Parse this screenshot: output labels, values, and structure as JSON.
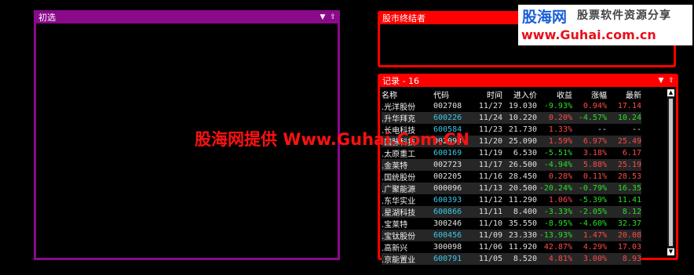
{
  "panels": {
    "initial": {
      "title": "初选"
    },
    "terminator": {
      "title": "股市终结者"
    },
    "record": {
      "title": "记录 - 16"
    }
  },
  "table": {
    "headers": [
      "名称",
      "代码",
      "时间",
      "进入价",
      "收益",
      "涨幅",
      "最新"
    ],
    "rows": [
      {
        "name": ".光洋股份",
        "code": "002708",
        "time": "11/27",
        "price": "19.030",
        "gain": "-9.93%",
        "chg": "0.94%",
        "last": "17.14"
      },
      {
        "name": ".升华拜克",
        "code": "600226",
        "time": "11/24",
        "price": "10.220",
        "gain": "0.20%",
        "chg": "-4.57%",
        "last": "10.24"
      },
      {
        "name": ".长电科技",
        "code": "600584",
        "time": "11/23",
        "price": "21.730",
        "gain": "1.33%",
        "chg": "--",
        "last": "--"
      },
      {
        "name": ".国脉科技",
        "code": "002093",
        "time": "11/20",
        "price": "25.090",
        "gain": "1.59%",
        "chg": "6.97%",
        "last": "25.49"
      },
      {
        "name": ".太原重工",
        "code": "600169",
        "time": "11/19",
        "price": "6.530",
        "gain": "-5.51%",
        "chg": "3.18%",
        "last": "6.17"
      },
      {
        "name": ".金莱特",
        "code": "002723",
        "time": "11/17",
        "price": "26.500",
        "gain": "-4.94%",
        "chg": "5.88%",
        "last": "25.19"
      },
      {
        "name": ".国统股份",
        "code": "002205",
        "time": "11/16",
        "price": "28.450",
        "gain": "0.28%",
        "chg": "0.11%",
        "last": "28.53"
      },
      {
        "name": ".广聚能源",
        "code": "000096",
        "time": "11/13",
        "price": "20.500",
        "gain": "-20.24%",
        "chg": "-0.79%",
        "last": "16.35"
      },
      {
        "name": ".东华实业",
        "code": "600393",
        "time": "11/12",
        "price": "11.290",
        "gain": "1.06%",
        "chg": "-5.39%",
        "last": "11.41"
      },
      {
        "name": ".星湖科技",
        "code": "600866",
        "time": "11/11",
        "price": "8.400",
        "gain": "-3.33%",
        "chg": "-2.05%",
        "last": "8.12"
      },
      {
        "name": ".宝莱特",
        "code": "300246",
        "time": "11/10",
        "price": "35.550",
        "gain": "-8.95%",
        "chg": "-4.60%",
        "last": "32.37"
      },
      {
        "name": ".宝钛股份",
        "code": "600456",
        "time": "11/09",
        "price": "23.330",
        "gain": "-13.93%",
        "chg": "1.47%",
        "last": "20.08"
      },
      {
        "name": ".高新兴",
        "code": "300098",
        "time": "11/06",
        "price": "11.920",
        "gain": "42.87%",
        "chg": "4.29%",
        "last": "17.03"
      },
      {
        "name": ".京能置业",
        "code": "600791",
        "time": "11/05",
        "price": "8.520",
        "gain": "4.81%",
        "chg": "3.00%",
        "last": "8.93"
      }
    ]
  },
  "logo": {
    "line1": "股海网",
    "line2": "股票软件资源分享",
    "line3": "www.Guhai.com.cn"
  },
  "watermark": "股海网提供 Www.Guhai.Com.CN",
  "colors": {
    "up": "#ff4a4a",
    "down": "#27e027",
    "flat": "#e0e0e0",
    "code_sh": "#3cc8e8",
    "code_sz": "#e0e0e0"
  }
}
